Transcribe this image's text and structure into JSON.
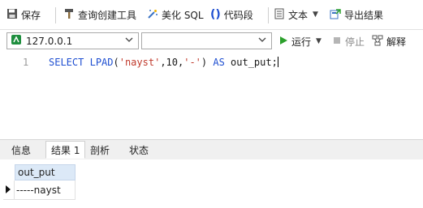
{
  "toolbar": {
    "save": "保存",
    "query_builder": "查询创建工具",
    "beautify_sql": "美化 SQL",
    "code_snippet": "代码段",
    "text": "文本",
    "export_results": "导出结果"
  },
  "connection": {
    "host": "127.0.0.1",
    "database": "",
    "run": "运行",
    "stop": "停止",
    "explain": "解释"
  },
  "editor": {
    "line_number": "1",
    "sql": "SELECT LPAD('nayst',10,'-') AS out_put;"
  },
  "tabs": [
    "信息",
    "结果 1",
    "剖析",
    "状态"
  ],
  "active_tab": "结果 1",
  "result": {
    "columns": [
      "out_put"
    ],
    "rows": [
      [
        "-----nayst"
      ]
    ]
  },
  "colors": {
    "accent": "#1f4fd1",
    "string": "#c0392b",
    "header_bg": "#dce9f7",
    "run_green": "#2ca02c"
  }
}
